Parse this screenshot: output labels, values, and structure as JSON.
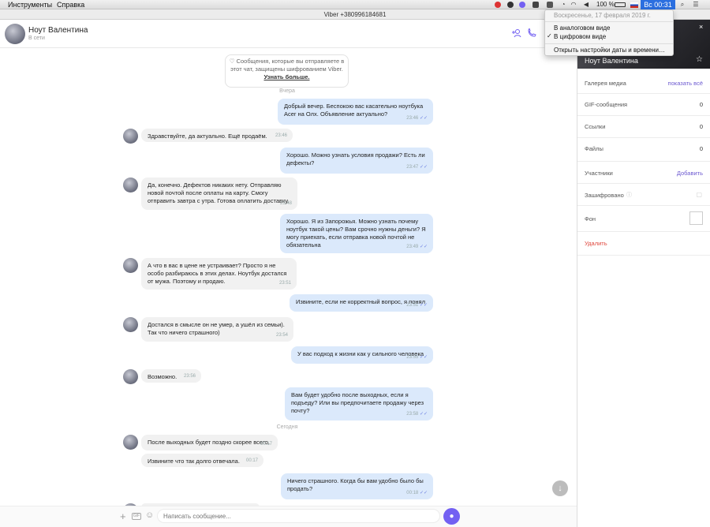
{
  "menubar": {
    "items": [
      "Инструменты",
      "Справка"
    ],
    "battery": "100 %",
    "clock": "Вс 00:31"
  },
  "window": {
    "title": "Viber +380996184681"
  },
  "chat_header": {
    "name": "Ноут Валентина",
    "status": "В сети"
  },
  "encryption_note": {
    "text": "Сообщения, которые вы отправляете в этот чат, защищены шифрованием Viber.",
    "link": "Узнать больше."
  },
  "days": {
    "yesterday": "Вчера",
    "today": "Сегодня"
  },
  "messages": [
    {
      "dir": "out",
      "text": "Добрый вечер. Беспокою вас касательно ноутбука Acer на Олх. Объявление актуально?",
      "time": "23:46"
    },
    {
      "dir": "in",
      "text": "Здравствуйте, да актуально. Ещё продаём.",
      "time": "23:46"
    },
    {
      "dir": "out",
      "text": "Хорошо. Можно узнать условия продажи? Есть ли дефекты?",
      "time": "23:47"
    },
    {
      "dir": "in",
      "text": "Да, конечно. Дефектов никаких нету. Отправляю новой почтой после оплаты на карту. Смогу отправить завтра с утра. Готова оплатить доставку.",
      "time": "23:48"
    },
    {
      "dir": "out",
      "text": "Хорошо. Я из Запорожья. Можно узнать почему ноутбук такой цены? Вам срочно нужны деньги? Я могу приехать, если отправка новой почтой не обязательна",
      "time": "23:49"
    },
    {
      "dir": "in",
      "text": "А что в вас в цене не устраивает? Просто я не особо разбираюсь в этих делах. Ноутбук достался от мужа. Поэтому и продаю.",
      "time": "23:51"
    },
    {
      "dir": "out",
      "text": "Извините, если не корректный вопрос, я понял",
      "time": "23:51"
    },
    {
      "dir": "in",
      "text": "Достался в смысле он не умер, а ушёл из семьи). Так что ничего страшного)",
      "time": "23:54"
    },
    {
      "dir": "out",
      "text": "У вас подход к жизни как у сильного человека",
      "time": "23:55"
    },
    {
      "dir": "in",
      "text": "Возможно.",
      "time": "23:56"
    },
    {
      "dir": "out",
      "text": "Вам будет удобно после выходных, если я подъеду? Или вы предпочитаете продажу через почту?",
      "time": "23:58"
    },
    {
      "dir": "in",
      "text": "После выходных будет поздно скорее всего.",
      "time": "00:17"
    },
    {
      "dir": "in",
      "text": "Извините что так долго отвечала.",
      "time": "00:17"
    },
    {
      "dir": "out",
      "text": "Ничего страшного. Когда бы вам удобно было бы продать?",
      "time": "00:18"
    }
  ],
  "composer": {
    "placeholder": "Написать сообщение..."
  },
  "panel": {
    "name": "Ноут Валентина",
    "rows": {
      "media": {
        "label": "Галерея медиа",
        "action": "показать всё"
      },
      "gif": {
        "label": "GIF-сообщения",
        "value": "0"
      },
      "links": {
        "label": "Ссылки",
        "value": "0"
      },
      "files": {
        "label": "Файлы",
        "value": "0"
      },
      "members": {
        "label": "Участники",
        "action": "Добавить"
      },
      "encrypted": {
        "label": "Зашифровано"
      },
      "background": {
        "label": "Фон"
      },
      "delete": {
        "label": "Удалить"
      }
    }
  },
  "clock_menu": {
    "date": "Воскресенье, 17 февраля 2019 г.",
    "analog": "В аналоговом виде",
    "digital": "В цифровом виде",
    "settings": "Открыть настройки даты и времени…",
    "checked": "digital"
  },
  "colors": {
    "accent": "#7360f2",
    "out_bubble": "#dbe9fb",
    "in_bubble": "#f1f1f1",
    "clock": "#2b6fe0",
    "delete": "#e0483e"
  }
}
